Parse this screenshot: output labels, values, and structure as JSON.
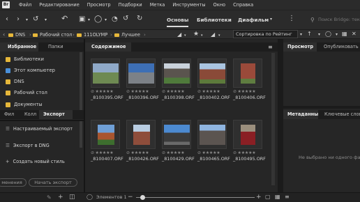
{
  "menubar": {
    "logo": "Br",
    "items": [
      "Файл",
      "Редактирование",
      "Просмотр",
      "Подборки",
      "Метка",
      "Инструменты",
      "Окно",
      "Справка"
    ]
  },
  "toolbar": {
    "workspaces": [
      "Основы",
      "Библиотеки",
      "Диафильм"
    ],
    "search_placeholder": "Поиск Bridge: текущ"
  },
  "path": {
    "crumbs": [
      "DNS",
      "Рабочий стол",
      "111OLYMP",
      "Лучшее"
    ],
    "sort_label": "Сортировка по Рейтинг"
  },
  "left_panel": {
    "tabs_top": [
      "Избранное",
      "Папки"
    ],
    "favorites": [
      {
        "label": "Библиотеки",
        "icon": "libraries-icon",
        "color": "#e6b73a"
      },
      {
        "label": "Этот компьютер",
        "icon": "computer-icon",
        "color": "#4a90d9"
      },
      {
        "label": "DNS",
        "icon": "folder-icon",
        "color": "#e6b73a"
      },
      {
        "label": "Рабочий стол",
        "icon": "folder-icon",
        "color": "#e6b73a"
      },
      {
        "label": "Документы",
        "icon": "documents-icon",
        "color": "#e6b73a"
      }
    ],
    "tabs_bottom": [
      "Фил",
      "Колл",
      "Экспорт"
    ],
    "export_items": [
      "Настраиваемый экспорт",
      "Экспорт в DNG",
      "Создать новый стиль"
    ],
    "cancel_button": "менения",
    "start_button": "Начать экспорт"
  },
  "content": {
    "tab": "Содержимое",
    "items": [
      {
        "name": "_8100395.ORF",
        "rating": 0
      },
      {
        "name": "_8100396.ORF",
        "rating": 0
      },
      {
        "name": "_8100398.ORF",
        "rating": 0
      },
      {
        "name": "_8100402.ORF",
        "rating": 0
      },
      {
        "name": "_8100406.ORF",
        "rating": 0
      },
      {
        "name": "_8100407.ORF",
        "rating": 0
      },
      {
        "name": "_8100426.ORF",
        "rating": 0
      },
      {
        "name": "_8100429.ORF",
        "rating": 0
      },
      {
        "name": "_8100465.ORF",
        "rating": 0
      },
      {
        "name": "_8100495.ORF",
        "rating": 0
      }
    ],
    "status": "Элементов 1"
  },
  "right_panel": {
    "tabs_top": [
      "Просмотр",
      "Опубликовать"
    ],
    "tabs_bottom": [
      "Метаданные",
      "Ключевые слова"
    ],
    "no_selection": "Не выбрано ни одного фа"
  }
}
